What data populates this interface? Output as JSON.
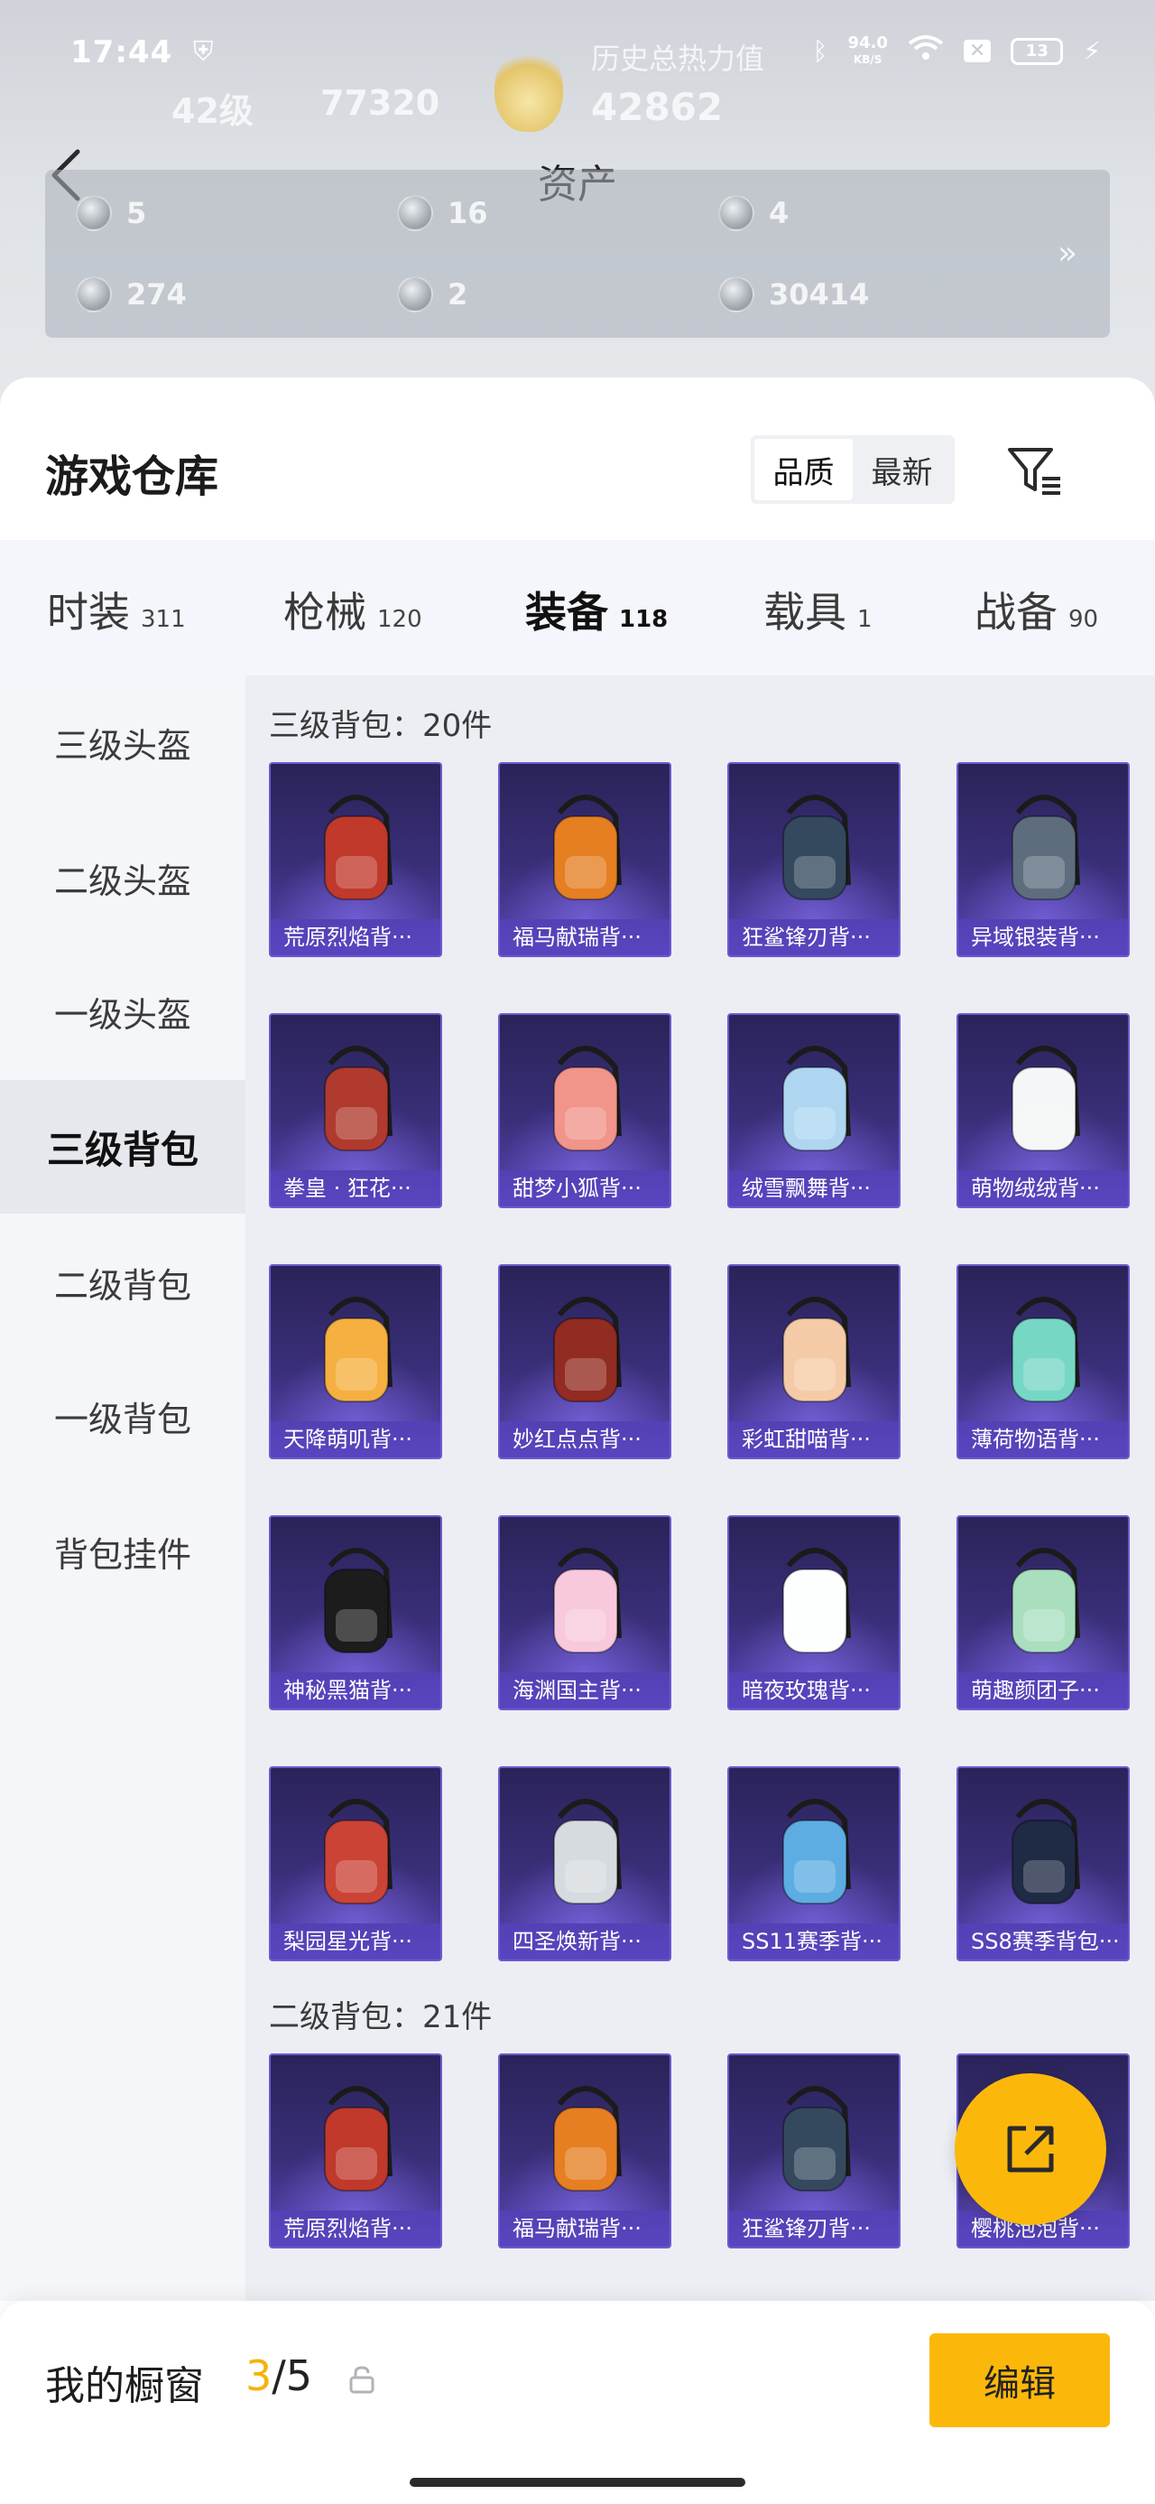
{
  "status_bar": {
    "time": "17:44",
    "net_speed_value": "94.0",
    "net_speed_unit": "KB/S",
    "battery": "13"
  },
  "background_stats": {
    "level": "42级",
    "coins": "77320",
    "heat_label": "历史总热力值",
    "heat_value": "42862"
  },
  "header": {
    "title": "资产"
  },
  "assets": [
    {
      "icon": "ticket-icon",
      "value": "5"
    },
    {
      "icon": "silver-coin-icon",
      "value": "16"
    },
    {
      "icon": "gold-badge-icon",
      "value": "4"
    },
    {
      "icon": "card-icon",
      "value": "274"
    },
    {
      "icon": "orb-icon",
      "value": "2"
    },
    {
      "icon": "bronze-coin-icon",
      "value": "30414"
    }
  ],
  "assets_more": "»",
  "warehouse": {
    "title": "游戏仓库",
    "sort_options": [
      "品质",
      "最新"
    ],
    "sort_selected": "品质"
  },
  "tabs": [
    {
      "name": "时装",
      "count": "311"
    },
    {
      "name": "枪械",
      "count": "120"
    },
    {
      "name": "装备",
      "count": "118",
      "active": true
    },
    {
      "name": "载具",
      "count": "1"
    },
    {
      "name": "战备",
      "count": "90"
    }
  ],
  "sidebar": [
    {
      "label": "三级头盔"
    },
    {
      "label": "二级头盔"
    },
    {
      "label": "一级头盔"
    },
    {
      "label": "三级背包",
      "active": true
    },
    {
      "label": "二级背包"
    },
    {
      "label": "一级背包"
    },
    {
      "label": "背包挂件"
    }
  ],
  "sections": [
    {
      "label": "三级背包：20件",
      "items": [
        {
          "name": "荒原烈焰背···",
          "color": "#c0392b"
        },
        {
          "name": "福马献瑞背···",
          "color": "#e67e22"
        },
        {
          "name": "狂鲨锋刃背···",
          "color": "#34495e"
        },
        {
          "name": "异域银装背···",
          "color": "#5d6d7e"
        },
        {
          "name": "拳皇 · 狂花···",
          "color": "#b03a2e"
        },
        {
          "name": "甜梦小狐背···",
          "color": "#f1948a"
        },
        {
          "name": "绒雪飘舞背···",
          "color": "#aed6f1"
        },
        {
          "name": "萌物绒绒背···",
          "color": "#f4f6f7"
        },
        {
          "name": "天降萌叽背···",
          "color": "#f5b041"
        },
        {
          "name": "妙红点点背···",
          "color": "#922b21"
        },
        {
          "name": "彩虹甜喵背···",
          "color": "#f5cba7"
        },
        {
          "name": "薄荷物语背···",
          "color": "#76d7c4"
        },
        {
          "name": "神秘黑猫背···",
          "color": "#1c1c1c"
        },
        {
          "name": "海渊国主背···",
          "color": "#f8c8dc"
        },
        {
          "name": "暗夜玫瑰背···",
          "color": "#fdfefe"
        },
        {
          "name": "萌趣颜团子···",
          "color": "#a9dfbf"
        },
        {
          "name": "梨园星光背···",
          "color": "#cb4335"
        },
        {
          "name": "四圣焕新背···",
          "color": "#d6dbdf"
        },
        {
          "name": "SS11赛季背···",
          "color": "#5dade2"
        },
        {
          "name": "SS8赛季背包···",
          "color": "#1f2a44"
        }
      ]
    },
    {
      "label": "二级背包：21件",
      "items": [
        {
          "name": "荒原烈焰背···",
          "color": "#c0392b"
        },
        {
          "name": "福马献瑞背···",
          "color": "#e67e22"
        },
        {
          "name": "狂鲨锋刃背···",
          "color": "#34495e"
        },
        {
          "name": "樱桃泡泡背···",
          "color": "#ec7063"
        }
      ]
    }
  ],
  "showcase": {
    "label": "我的橱窗",
    "current": "3",
    "separator": "/",
    "total": "5",
    "edit_label": "编辑"
  },
  "colors": {
    "accent": "#fbb80b",
    "card_bg": "#3a2f7a"
  }
}
